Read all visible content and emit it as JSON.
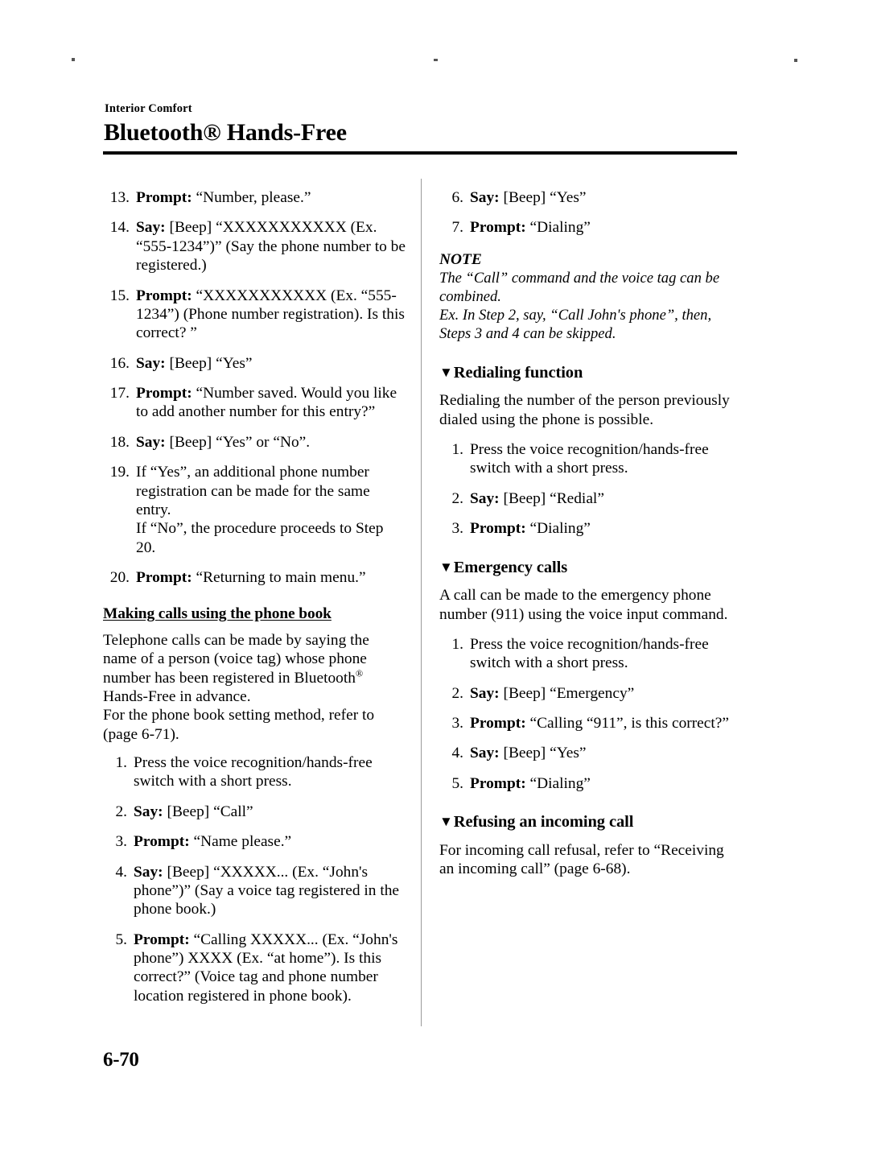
{
  "marks": {
    "registration_left": "registration-dot",
    "registration_center": "registration-dot",
    "registration_right": "registration-dot"
  },
  "header": {
    "breadcrumb": "Interior Comfort",
    "title_prefix": "Bluetooth",
    "title_registered": "®",
    "title_suffix": " Hands-Free"
  },
  "left_column": {
    "continued_steps": [
      {
        "num": "13.",
        "label": "Prompt:",
        "text": " “Number, please.”"
      },
      {
        "num": "14.",
        "label": "Say:",
        "text": " [Beep] “XXXXXXXXXXX (Ex. “555-1234”)” (Say the phone number to be registered.)"
      },
      {
        "num": "15.",
        "label": "Prompt:",
        "text": " “XXXXXXXXXXX (Ex. “555-1234”) (Phone number registration). Is this correct? ”"
      },
      {
        "num": "16.",
        "label": "Say:",
        "text": " [Beep] “Yes”"
      },
      {
        "num": "17.",
        "label": "Prompt:",
        "text": " “Number saved. Would you like to add another number for this entry?”"
      },
      {
        "num": "18.",
        "label": "Say:",
        "text": " [Beep] “Yes” or “No”."
      },
      {
        "num": "19.",
        "label": "",
        "text": "If “Yes”, an additional phone number registration can be made for the same entry.\nIf “No”, the procedure proceeds to Step 20."
      },
      {
        "num": "20.",
        "label": "Prompt:",
        "text": " “Returning to main menu.”"
      }
    ],
    "phonebook_heading": "Making calls using the phone book",
    "phonebook_intro_part1": "Telephone calls can be made by saying the name of a person (voice tag) whose phone number has been registered in Bluetooth",
    "phonebook_intro_registered": "®",
    "phonebook_intro_part2": " Hands-Free in advance.",
    "phonebook_intro_line2": "For the phone book setting method, refer to (page 6-71).",
    "phonebook_steps": [
      {
        "num": "1.",
        "label": "",
        "text": "Press the voice recognition/hands-free switch with a short press."
      },
      {
        "num": "2.",
        "label": "Say:",
        "text": " [Beep] “Call”"
      },
      {
        "num": "3.",
        "label": "Prompt:",
        "text": " “Name please.”"
      },
      {
        "num": "4.",
        "label": "Say:",
        "text": " [Beep] “XXXXX... (Ex. “John's phone”)” (Say a voice tag registered in the phone book.)"
      },
      {
        "num": "5.",
        "label": "Prompt:",
        "text": " “Calling XXXXX... (Ex. “John's phone”) XXXX (Ex. “at home”). Is this correct?” (Voice tag and phone number location registered in phone book)."
      }
    ]
  },
  "right_column": {
    "continued_steps": [
      {
        "num": "6.",
        "label": "Say:",
        "text": " [Beep] “Yes”"
      },
      {
        "num": "7.",
        "label": "Prompt:",
        "text": " “Dialing”"
      }
    ],
    "note": {
      "label": "NOTE",
      "line1": "The “Call” command and the voice tag can be combined.",
      "line2": "Ex. In Step 2, say, “Call John's phone”, then, Steps 3 and 4 can be skipped."
    },
    "redialing": {
      "triangle": "▼",
      "heading": "Redialing function",
      "intro": "Redialing the number of the person previously dialed using the phone is possible.",
      "steps": [
        {
          "num": "1.",
          "label": "",
          "text": "Press the voice recognition/hands-free switch with a short press."
        },
        {
          "num": "2.",
          "label": "Say:",
          "text": " [Beep] “Redial”"
        },
        {
          "num": "3.",
          "label": "Prompt:",
          "text": " “Dialing”"
        }
      ]
    },
    "emergency": {
      "triangle": "▼",
      "heading": "Emergency calls",
      "intro": "A call can be made to the emergency phone number (911) using the voice input command.",
      "steps": [
        {
          "num": "1.",
          "label": "",
          "text": "Press the voice recognition/hands-free switch with a short press."
        },
        {
          "num": "2.",
          "label": "Say:",
          "text": " [Beep] “Emergency”"
        },
        {
          "num": "3.",
          "label": "Prompt:",
          "text": " “Calling “911”, is this correct?”"
        },
        {
          "num": "4.",
          "label": "Say:",
          "text": " [Beep] “Yes”"
        },
        {
          "num": "5.",
          "label": "Prompt:",
          "text": " “Dialing”"
        }
      ]
    },
    "refusing": {
      "triangle": "▼",
      "heading": "Refusing an incoming call",
      "body": "For incoming call refusal, refer to “Receiving an incoming call” (page 6-68)."
    }
  },
  "footer": {
    "page_number": "6-70"
  }
}
